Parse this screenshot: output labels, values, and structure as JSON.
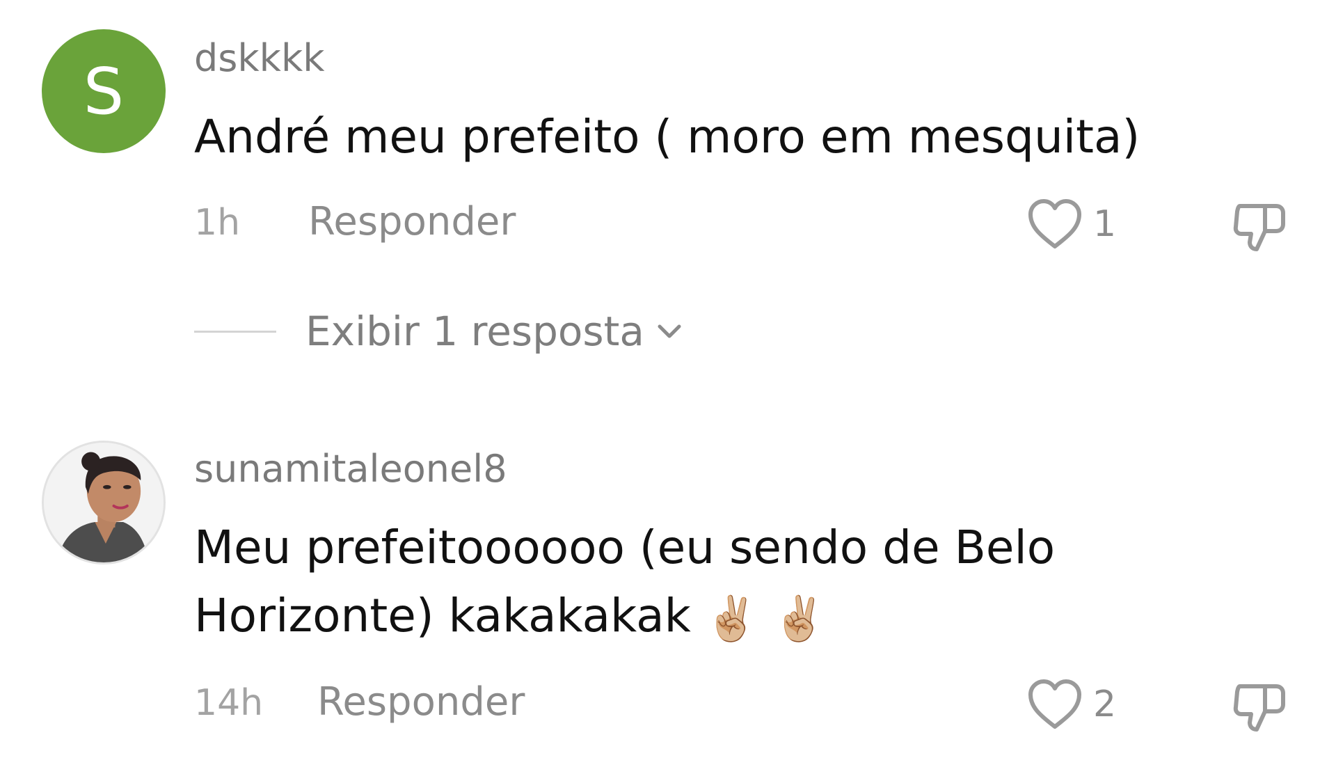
{
  "comments": [
    {
      "avatar_letter": "S",
      "avatar_color": "#6aa33a",
      "username": "dskkkk",
      "text": "André meu prefeito ( moro em mesquita)",
      "time": "1h",
      "reply_label": "Responder",
      "like_count": "1",
      "view_replies_label": "Exibir 1 resposta"
    },
    {
      "username": "sunamitaleonel8",
      "text_line1": "Meu prefeitoooooo (eu sendo de Belo",
      "text_line2": "Horizonte) kakakakak",
      "emoji_1": "✌🏼",
      "emoji_2": "✌🏼",
      "time": "14h",
      "reply_label": "Responder",
      "like_count": "2"
    }
  ],
  "icons": {
    "like": "heart-outline-icon",
    "dislike": "thumbs-down-outline-icon",
    "expand": "chevron-down-icon"
  }
}
